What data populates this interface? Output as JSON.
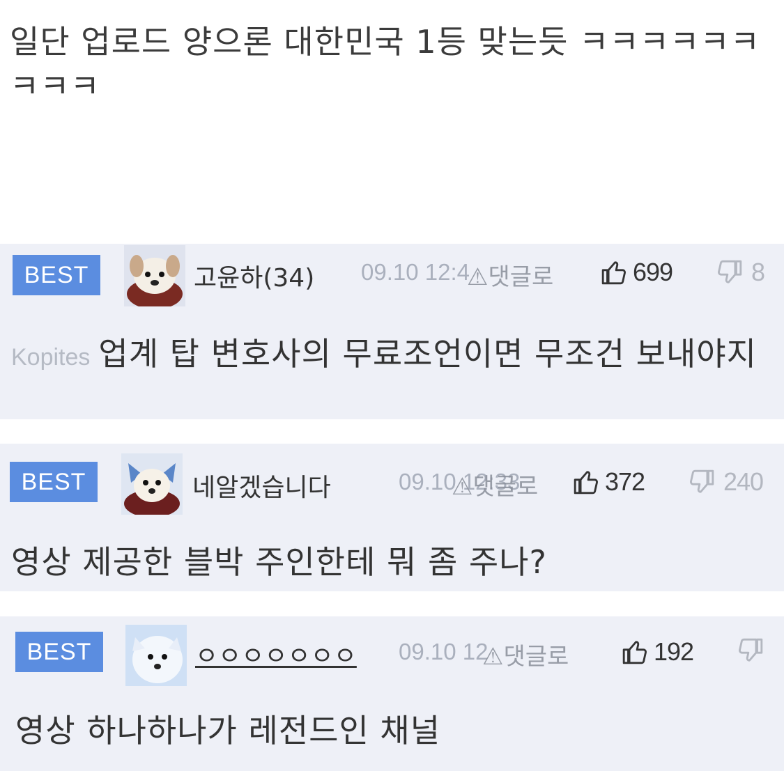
{
  "post": {
    "text": "일단 업로드 양으론 대한민국 1등 맞는듯 ㅋㅋㅋㅋㅋㅋㅋㅋㅋ"
  },
  "comments": [
    {
      "badge": "BEST",
      "nickname": "고윤하(34)",
      "date": "09.10 12:4",
      "report": "댓글로",
      "likes": "699",
      "dislikes": "8",
      "source": "Kopites",
      "text": "업계 탑 변호사의 무료조언이면 무조건 보내야지"
    },
    {
      "badge": "BEST",
      "nickname": "네알겠습니다",
      "date": "09.10 12:33",
      "report": "댓글로",
      "likes": "372",
      "dislikes": "240",
      "text": "영상 제공한 블박 주인한테 뭐 좀 주나?"
    },
    {
      "badge": "BEST",
      "nickname": "ㅇㅇㅇㅇㅇㅇㅇ",
      "date": "09.10 12",
      "report": "댓글로",
      "likes": "192",
      "text": "영상 하나하나가 레전드인 채널"
    }
  ],
  "icons": {
    "like": "thumbs-up-icon",
    "dislike": "thumbs-down-icon",
    "report": "siren-icon"
  },
  "colors": {
    "badge": "#5b8de0",
    "comment_bg": "#eef0f7",
    "meta_gray": "#aab0bd"
  }
}
